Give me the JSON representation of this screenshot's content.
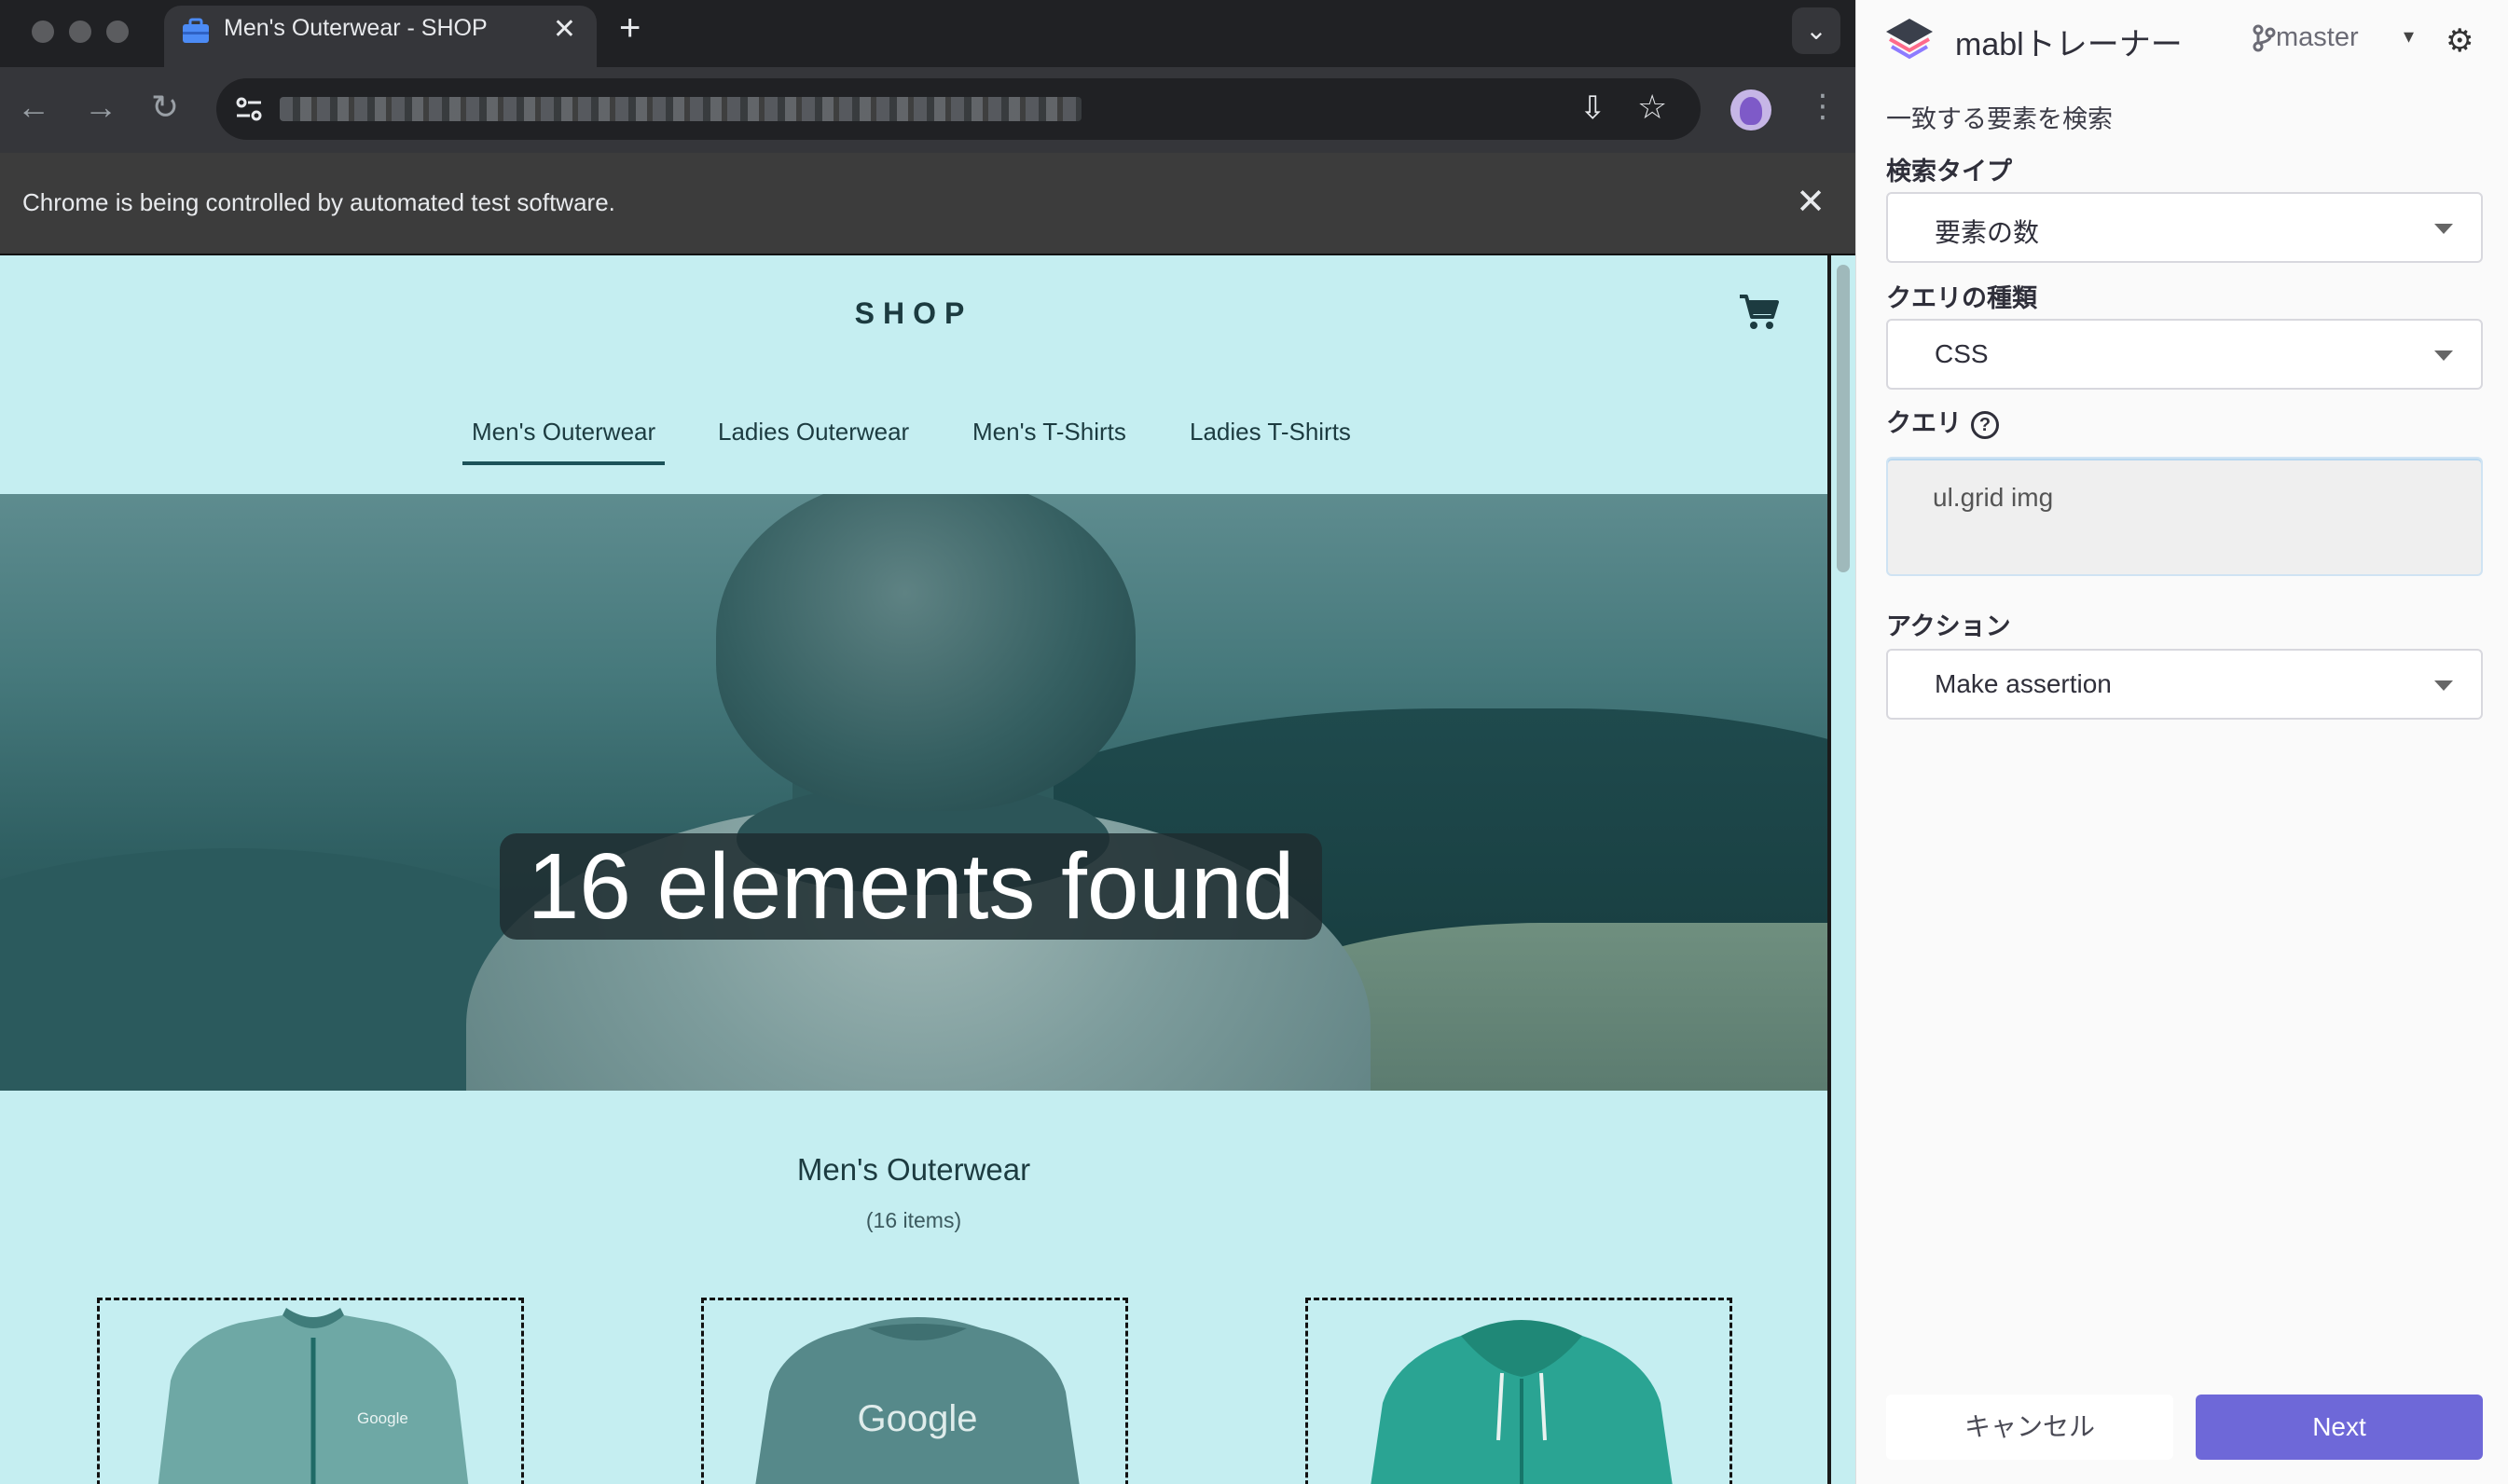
{
  "browser": {
    "tab": {
      "title": "Men's Outerwear - SHOP",
      "close": "✕"
    },
    "new_tab": "+",
    "tab_search": "⌄",
    "nav": {
      "back": "←",
      "forward": "→",
      "reload": "↻"
    },
    "toolbar": {
      "install": "⇩",
      "bookmark": "☆",
      "menu": "⋮"
    },
    "infobar": {
      "message": "Chrome is being controlled by automated test software.",
      "close": "✕"
    }
  },
  "page": {
    "shop_title": "SHOP",
    "nav_items": [
      "Men's Outerwear",
      "Ladies Outerwear",
      "Men's T-Shirts",
      "Ladies T-Shirts"
    ],
    "active_nav": "Men's Outerwear",
    "found_badge": "16 elements found",
    "section_title": "Men's Outerwear",
    "section_count": "(16 items)",
    "products": [
      {
        "brand_text": "Google",
        "color": "#5f9896"
      },
      {
        "brand_text": "Google",
        "color": "#4f8283"
      },
      {
        "brand_text": "",
        "color": "#259b8a"
      }
    ]
  },
  "panel": {
    "brand": "mablトレーナー",
    "branch": "master",
    "heading": "一致する要素を検索",
    "search_type": {
      "label": "検索タイプ",
      "value": "要素の数"
    },
    "query_kind": {
      "label": "クエリの種類",
      "value": "CSS"
    },
    "query": {
      "label": "クエリ",
      "help": "?",
      "value": "ul.grid img"
    },
    "action": {
      "label": "アクション",
      "value": "Make assertion"
    },
    "cancel_label": "キャンセル",
    "next_label": "Next",
    "colors": {
      "accent": "#6e68d8"
    }
  }
}
